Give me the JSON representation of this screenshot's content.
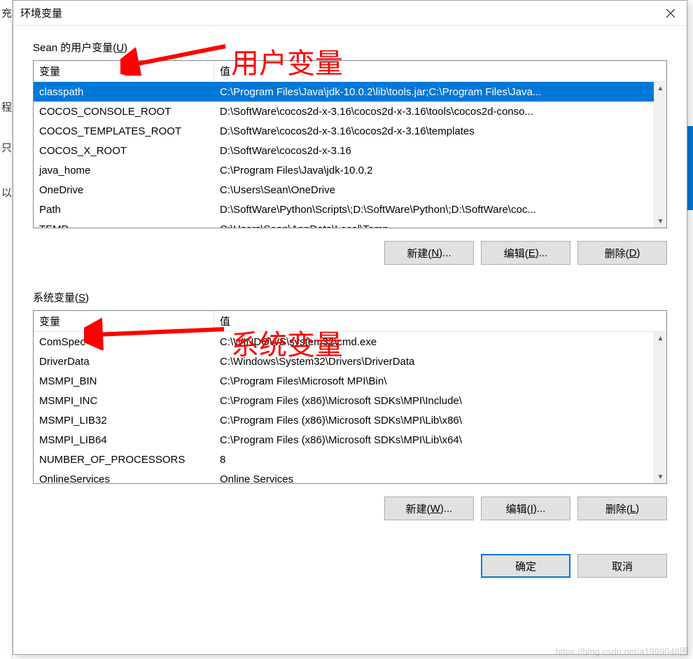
{
  "window": {
    "title": "环境变量"
  },
  "user_section": {
    "label_prefix": "Sean 的用户变量(",
    "label_hotkey": "U",
    "label_suffix": ")",
    "header_name": "变量",
    "header_value": "值",
    "rows": [
      {
        "name": "classpath",
        "value": "C:\\Program Files\\Java\\jdk-10.0.2\\lib\\tools.jar;C:\\Program Files\\Java...",
        "selected": true
      },
      {
        "name": "COCOS_CONSOLE_ROOT",
        "value": "D:\\SoftWare\\cocos2d-x-3.16\\cocos2d-x-3.16\\tools\\cocos2d-conso..."
      },
      {
        "name": "COCOS_TEMPLATES_ROOT",
        "value": "D:\\SoftWare\\cocos2d-x-3.16\\cocos2d-x-3.16\\templates"
      },
      {
        "name": "COCOS_X_ROOT",
        "value": "D:\\SoftWare\\cocos2d-x-3.16"
      },
      {
        "name": "java_home",
        "value": "C:\\Program Files\\Java\\jdk-10.0.2"
      },
      {
        "name": "OneDrive",
        "value": "C:\\Users\\Sean\\OneDrive"
      },
      {
        "name": "Path",
        "value": "D:\\SoftWare\\Python\\Scripts\\;D:\\SoftWare\\Python\\;D:\\SoftWare\\coc..."
      },
      {
        "name": "TEMP",
        "value": "C:\\Users\\Sean\\AppData\\Local\\Temp"
      }
    ],
    "buttons": {
      "new": {
        "prefix": "新建(",
        "hotkey": "N",
        "suffix": ")..."
      },
      "edit": {
        "prefix": "编辑(",
        "hotkey": "E",
        "suffix": ")..."
      },
      "delete": {
        "prefix": "删除(",
        "hotkey": "D",
        "suffix": ")"
      }
    }
  },
  "system_section": {
    "label_prefix": "系统变量(",
    "label_hotkey": "S",
    "label_suffix": ")",
    "header_name": "变量",
    "header_value": "值",
    "rows": [
      {
        "name": "ComSpec",
        "value": "C:\\WINDOWS\\system32\\cmd.exe"
      },
      {
        "name": "DriverData",
        "value": "C:\\Windows\\System32\\Drivers\\DriverData"
      },
      {
        "name": "MSMPI_BIN",
        "value": "C:\\Program Files\\Microsoft MPI\\Bin\\"
      },
      {
        "name": "MSMPI_INC",
        "value": "C:\\Program Files (x86)\\Microsoft SDKs\\MPI\\Include\\"
      },
      {
        "name": "MSMPI_LIB32",
        "value": "C:\\Program Files (x86)\\Microsoft SDKs\\MPI\\Lib\\x86\\"
      },
      {
        "name": "MSMPI_LIB64",
        "value": "C:\\Program Files (x86)\\Microsoft SDKs\\MPI\\Lib\\x64\\"
      },
      {
        "name": "NUMBER_OF_PROCESSORS",
        "value": "8"
      },
      {
        "name": "OnlineServices",
        "value": "Online Services"
      }
    ],
    "buttons": {
      "new": {
        "prefix": "新建(",
        "hotkey": "W",
        "suffix": ")..."
      },
      "edit": {
        "prefix": "编辑(",
        "hotkey": "I",
        "suffix": ")..."
      },
      "delete": {
        "prefix": "删除(",
        "hotkey": "L",
        "suffix": ")"
      }
    }
  },
  "dialog_buttons": {
    "ok": "确定",
    "cancel": "取消"
  },
  "annotations": {
    "user_label": "用户变量",
    "system_label": "系统变量"
  },
  "sidechars": {
    "c1": "充",
    "c2": "程",
    "c3": "只",
    "c4": "以"
  },
  "watermark": "https://blog.csdn.net/a1999048图"
}
